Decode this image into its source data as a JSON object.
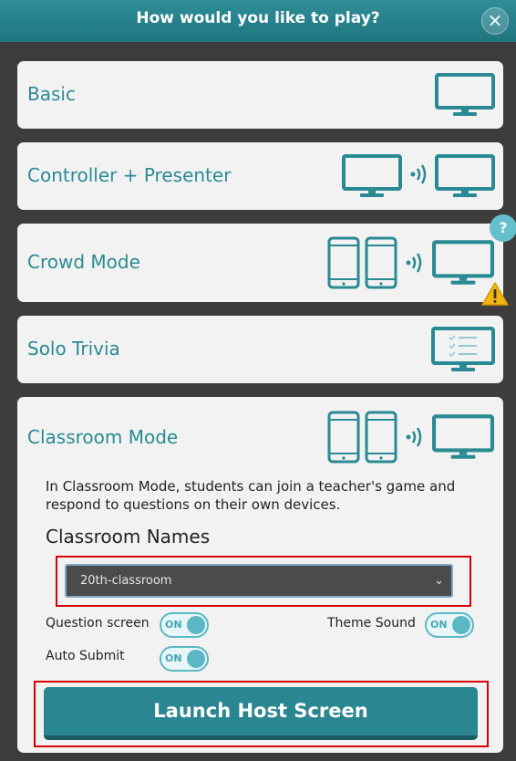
{
  "dialog": {
    "title": "How would you like to play?",
    "close_glyph": "×"
  },
  "modes": [
    {
      "label": "Basic"
    },
    {
      "label": "Controller + Presenter"
    },
    {
      "label": "Crowd Mode"
    },
    {
      "label": "Solo Trivia"
    },
    {
      "label": "Classroom Mode"
    }
  ],
  "help_badge": "?",
  "classroom": {
    "description": "In Classroom Mode, students can join a teacher's game and respond to questions on their own devices.",
    "names_heading": "Classroom Names",
    "selected_classroom": "20th-classroom",
    "toggles": [
      {
        "label": "Question screen",
        "state": "ON"
      },
      {
        "label": "Theme Sound",
        "state": "ON"
      },
      {
        "label": "Auto Submit",
        "state": "ON"
      }
    ],
    "launch_label": "Launch Host Screen"
  },
  "colors": {
    "accent": "#2a8a94",
    "highlight": "#d80000"
  },
  "icons": [
    "monitor-icon",
    "wireless-signal-icon",
    "phone-icon",
    "checklist-monitor-icon",
    "question-icon",
    "warning-icon",
    "close-icon",
    "chevron-down-icon"
  ]
}
